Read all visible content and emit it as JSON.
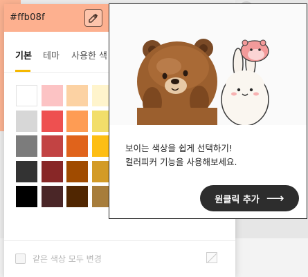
{
  "picker": {
    "hex_value": "#ffb08f",
    "header_color": "#fdb08f",
    "tabs": [
      {
        "label": "기본",
        "active": true
      },
      {
        "label": "테마",
        "active": false
      },
      {
        "label": "사용한 색",
        "active": false
      }
    ],
    "swatch_rows": [
      [
        "#ffffff",
        "#fcc3c4",
        "#fcd2a3",
        "#fff4cc"
      ],
      [
        "#d7d7d7",
        "#ee5050",
        "#fe9c54",
        "#f2de6a"
      ],
      [
        "#7c7c7c",
        "#c24343",
        "#e0631b",
        "#fdbe14"
      ],
      [
        "#333333",
        "#882727",
        "#a04b00",
        "#d39b27"
      ],
      [
        "#000000",
        "#4a2627",
        "#502601",
        "#a77d3b"
      ]
    ],
    "same_color_label": "같은 색상 모두 변경"
  },
  "tooltip": {
    "line1": "보이는 색상을 쉽게 선택하기!",
    "line2": "컬러피커 기능을 사용해보세요.",
    "button_label": "원클릭 추가",
    "button_arrow": "⟶"
  },
  "colors": {
    "accent": "#f5b800",
    "button_bg": "#2d2d2d"
  }
}
